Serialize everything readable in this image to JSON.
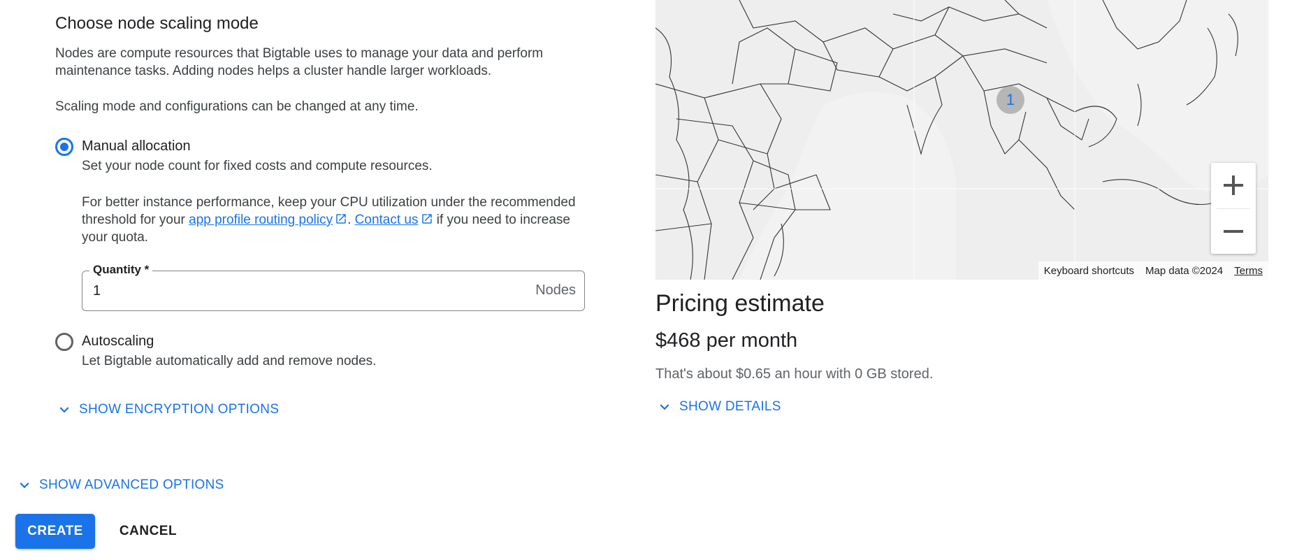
{
  "scaling": {
    "title": "Choose node scaling mode",
    "description": "Nodes are compute resources that Bigtable uses to manage your data and perform maintenance tasks. Adding nodes helps a cluster handle larger workloads.",
    "note": "Scaling mode and configurations can be changed at any time.",
    "manual": {
      "label": "Manual allocation",
      "sublabel": "Set your node count for fixed costs and compute resources.",
      "selected": true
    },
    "perf_note": {
      "prefix": "For better instance performance, keep your CPU utilization under the recommended threshold for your",
      "link1": "app profile routing policy",
      "mid": ".",
      "link2": "Contact us",
      "suffix": "if you need to increase your quota."
    },
    "quantity": {
      "label": "Quantity *",
      "value": "1",
      "suffix": "Nodes"
    },
    "autoscaling": {
      "label": "Autoscaling",
      "sublabel": "Let Bigtable automatically add and remove nodes.",
      "selected": false
    },
    "encryption_toggle": "SHOW ENCRYPTION OPTIONS"
  },
  "advanced_toggle": "SHOW ADVANCED OPTIONS",
  "actions": {
    "create": "CREATE",
    "cancel": "CANCEL"
  },
  "map": {
    "marker_count": "1",
    "keyboard_shortcuts": "Keyboard shortcuts",
    "map_data": "Map data ©2024",
    "terms": "Terms",
    "colors": {
      "land": "#eeeeee",
      "border": "#333333",
      "marker": "#b6b6b6"
    }
  },
  "pricing": {
    "title": "Pricing estimate",
    "price": "$468 per month",
    "detail": "That's about $0.65 an hour with 0 GB stored.",
    "details_toggle": "SHOW DETAILS"
  },
  "colors": {
    "accent": "#1a73e8",
    "text": "#202124",
    "secondary": "#3c4043"
  }
}
